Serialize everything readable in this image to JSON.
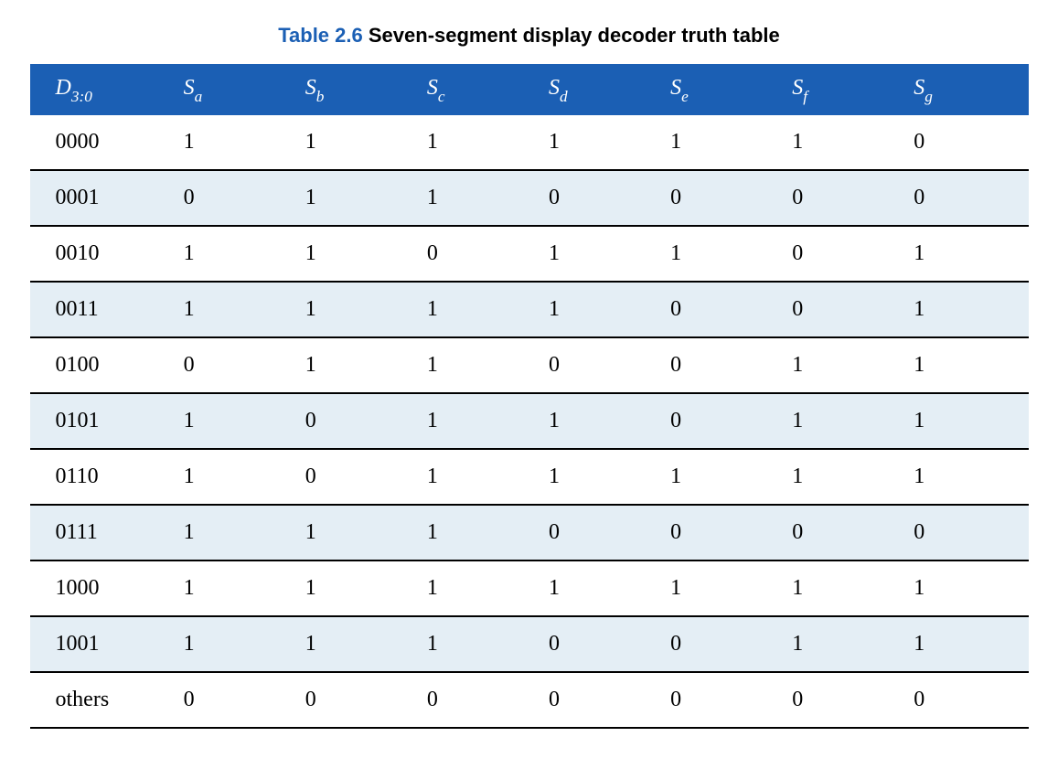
{
  "caption": {
    "label": "Table 2.6",
    "title": "Seven-segment display decoder truth table"
  },
  "headers": {
    "d": {
      "base": "D",
      "sub": "3:0"
    },
    "sa": {
      "base": "S",
      "sub": "a"
    },
    "sb": {
      "base": "S",
      "sub": "b"
    },
    "sc": {
      "base": "S",
      "sub": "c"
    },
    "sd": {
      "base": "S",
      "sub": "d"
    },
    "se": {
      "base": "S",
      "sub": "e"
    },
    "sf": {
      "base": "S",
      "sub": "f"
    },
    "sg": {
      "base": "S",
      "sub": "g"
    }
  },
  "rows": [
    {
      "d": "0000",
      "sa": "1",
      "sb": "1",
      "sc": "1",
      "sd": "1",
      "se": "1",
      "sf": "1",
      "sg": "0",
      "shaded": false
    },
    {
      "d": "0001",
      "sa": "0",
      "sb": "1",
      "sc": "1",
      "sd": "0",
      "se": "0",
      "sf": "0",
      "sg": "0",
      "shaded": true
    },
    {
      "d": "0010",
      "sa": "1",
      "sb": "1",
      "sc": "0",
      "sd": "1",
      "se": "1",
      "sf": "0",
      "sg": "1",
      "shaded": false
    },
    {
      "d": "0011",
      "sa": "1",
      "sb": "1",
      "sc": "1",
      "sd": "1",
      "se": "0",
      "sf": "0",
      "sg": "1",
      "shaded": true
    },
    {
      "d": "0100",
      "sa": "0",
      "sb": "1",
      "sc": "1",
      "sd": "0",
      "se": "0",
      "sf": "1",
      "sg": "1",
      "shaded": false
    },
    {
      "d": "0101",
      "sa": "1",
      "sb": "0",
      "sc": "1",
      "sd": "1",
      "se": "0",
      "sf": "1",
      "sg": "1",
      "shaded": true
    },
    {
      "d": "0110",
      "sa": "1",
      "sb": "0",
      "sc": "1",
      "sd": "1",
      "se": "1",
      "sf": "1",
      "sg": "1",
      "shaded": false
    },
    {
      "d": "0111",
      "sa": "1",
      "sb": "1",
      "sc": "1",
      "sd": "0",
      "se": "0",
      "sf": "0",
      "sg": "0",
      "shaded": true
    },
    {
      "d": "1000",
      "sa": "1",
      "sb": "1",
      "sc": "1",
      "sd": "1",
      "se": "1",
      "sf": "1",
      "sg": "1",
      "shaded": false
    },
    {
      "d": "1001",
      "sa": "1",
      "sb": "1",
      "sc": "1",
      "sd": "0",
      "se": "0",
      "sf": "1",
      "sg": "1",
      "shaded": true
    },
    {
      "d": "others",
      "sa": "0",
      "sb": "0",
      "sc": "0",
      "sd": "0",
      "se": "0",
      "sf": "0",
      "sg": "0",
      "shaded": false
    }
  ],
  "chart_data": {
    "type": "table",
    "title": "Table 2.6 Seven-segment display decoder truth table",
    "columns": [
      "D3:0",
      "Sa",
      "Sb",
      "Sc",
      "Sd",
      "Se",
      "Sf",
      "Sg"
    ],
    "rows": [
      [
        "0000",
        1,
        1,
        1,
        1,
        1,
        1,
        0
      ],
      [
        "0001",
        0,
        1,
        1,
        0,
        0,
        0,
        0
      ],
      [
        "0010",
        1,
        1,
        0,
        1,
        1,
        0,
        1
      ],
      [
        "0011",
        1,
        1,
        1,
        1,
        0,
        0,
        1
      ],
      [
        "0100",
        0,
        1,
        1,
        0,
        0,
        1,
        1
      ],
      [
        "0101",
        1,
        0,
        1,
        1,
        0,
        1,
        1
      ],
      [
        "0110",
        1,
        0,
        1,
        1,
        1,
        1,
        1
      ],
      [
        "0111",
        1,
        1,
        1,
        0,
        0,
        0,
        0
      ],
      [
        "1000",
        1,
        1,
        1,
        1,
        1,
        1,
        1
      ],
      [
        "1001",
        1,
        1,
        1,
        0,
        0,
        1,
        1
      ],
      [
        "others",
        0,
        0,
        0,
        0,
        0,
        0,
        0
      ]
    ]
  }
}
